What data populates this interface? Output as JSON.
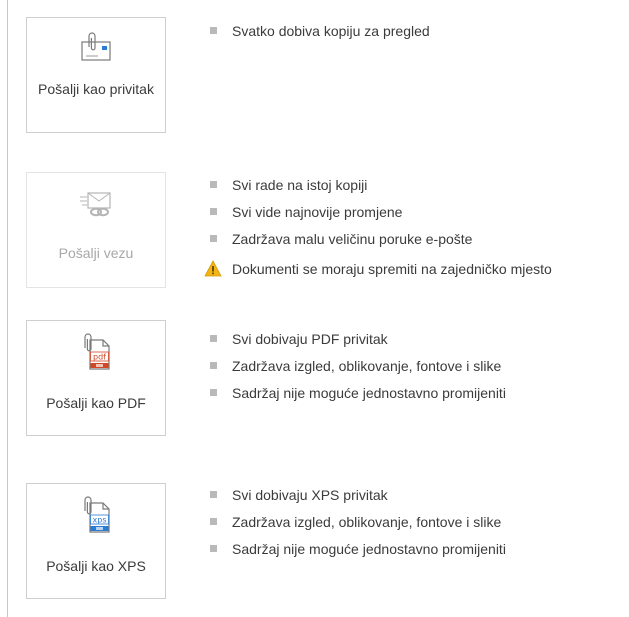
{
  "options": [
    {
      "id": "attachment",
      "label": "Pošalji kao privitak",
      "icon": "attachment-envelope-icon",
      "disabled": false,
      "bullets": [
        "Svatko dobiva kopiju za pregled"
      ]
    },
    {
      "id": "link",
      "label": "Pošalji vezu",
      "icon": "link-envelope-icon",
      "disabled": true,
      "bullets": [
        "Svi rade na istoj kopiji",
        "Svi vide najnovije promjene",
        "Zadržava malu veličinu poruke e-pošte"
      ],
      "warning": "Dokumenti se moraju spremiti na zajedničko mjesto"
    },
    {
      "id": "pdf",
      "label": "Pošalji kao PDF",
      "icon": "pdf-file-icon",
      "icon_text": "pdf",
      "disabled": false,
      "bullets": [
        "Svi dobivaju PDF privitak",
        "Zadržava izgled, oblikovanje, fontove i slike",
        "Sadržaj nije moguće jednostavno promijeniti"
      ]
    },
    {
      "id": "xps",
      "label": "Pošalji kao XPS",
      "icon": "xps-file-icon",
      "icon_text": "xps",
      "disabled": false,
      "bullets": [
        "Svi dobivaju XPS privitak",
        "Zadržava izgled, oblikovanje, fontove i slike",
        "Sadržaj nije moguće jednostavno promijeniti"
      ]
    }
  ],
  "colors": {
    "pdf_accent": "#d24726",
    "xps_accent": "#2b7cd3",
    "icon_gray": "#7a7a7a",
    "bullet_square": "#b9b9b9",
    "warning_yellow": "#f2b515"
  }
}
